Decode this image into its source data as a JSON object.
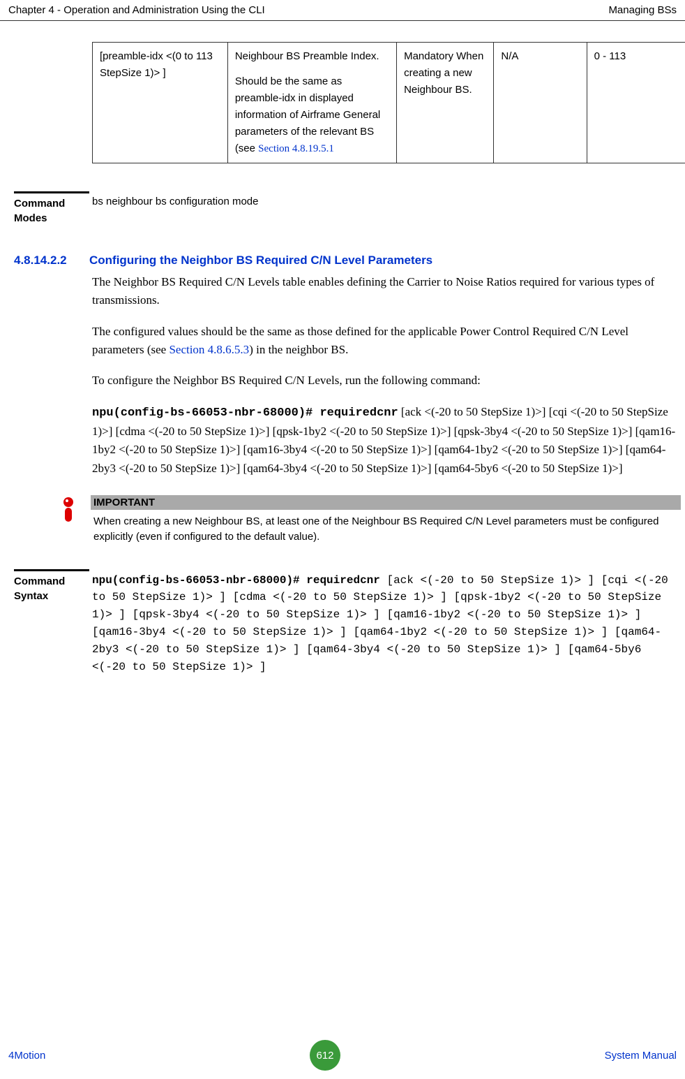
{
  "header": {
    "left": "Chapter 4 - Operation and Administration Using the CLI",
    "right": "Managing BSs"
  },
  "table_row": {
    "param": "[preamble-idx <(0 to 113 StepSize 1)> ]",
    "desc_main": "Neighbour BS Preamble Index.",
    "desc_sub": "Should be the same as preamble-idx in displayed information of Airframe General parameters of the relevant BS (see ",
    "desc_link": "Section 4.8.19.5.1",
    "presence": "Mandatory When creating a new Neighbour BS.",
    "default": "N/A",
    "range": "0 - 113"
  },
  "modes": {
    "label": "Command Modes",
    "text": "bs neighbour bs configuration mode"
  },
  "section": {
    "num": "4.8.14.2.2",
    "title": "Configuring the Neighbor BS Required C/N Level Parameters"
  },
  "p1": "The Neighbor BS Required C/N Levels table enables defining the Carrier to Noise Ratios required for various types of transmissions.",
  "p2a": "The configured values should be the same as those defined for the applicable Power Control Required C/N Level parameters (see ",
  "p2link": "Section 4.8.6.5.3",
  "p2b": ") in the neighbor BS.",
  "p3": "To configure the Neighbor BS Required C/N Levels, run the following command:",
  "cmd_intro_bold": "npu(config-bs-66053-nbr-68000)# requiredcnr",
  "cmd_intro_rest": " [ack <(-20 to 50 StepSize 1)>] [cqi <(-20 to 50 StepSize 1)>] [cdma <(-20 to 50 StepSize 1)>] [qpsk-1by2 <(-20 to 50 StepSize 1)>] [qpsk-3by4 <(-20 to 50 StepSize 1)>] [qam16-1by2 <(-20 to 50 StepSize 1)>] [qam16-3by4 <(-20 to 50 StepSize 1)>] [qam64-1by2 <(-20 to 50 StepSize 1)>] [qam64-2by3 <(-20 to 50 StepSize 1)>] [qam64-3by4 <(-20 to 50 StepSize 1)>] [qam64-5by6 <(-20 to 50 StepSize 1)>]",
  "important": {
    "head": "IMPORTANT",
    "text": "When creating a new Neighbour BS, at least one of the Neighbour BS Required C/N Level parameters must be configured explicitly (even if configured to the default value)."
  },
  "syntax": {
    "label": "Command Syntax",
    "bold": "npu(config-bs-66053-nbr-68000)# requiredcnr",
    "rest": " [ack <(-20 to 50 StepSize 1)> ] [cqi <(-20 to 50 StepSize 1)> ] [cdma <(-20 to 50 StepSize 1)> ] [qpsk-1by2 <(-20 to 50 StepSize 1)> ] [qpsk-3by4 <(-20 to 50 StepSize 1)> ] [qam16-1by2 <(-20 to 50 StepSize 1)> ] [qam16-3by4 <(-20 to 50 StepSize 1)> ] [qam64-1by2 <(-20 to 50 StepSize 1)> ] [qam64-2by3 <(-20 to 50 StepSize 1)> ] [qam64-3by4 <(-20 to 50 StepSize 1)> ] [qam64-5by6 <(-20 to 50 StepSize 1)> ]"
  },
  "footer": {
    "left": "4Motion",
    "page": "612",
    "right": "System Manual"
  }
}
